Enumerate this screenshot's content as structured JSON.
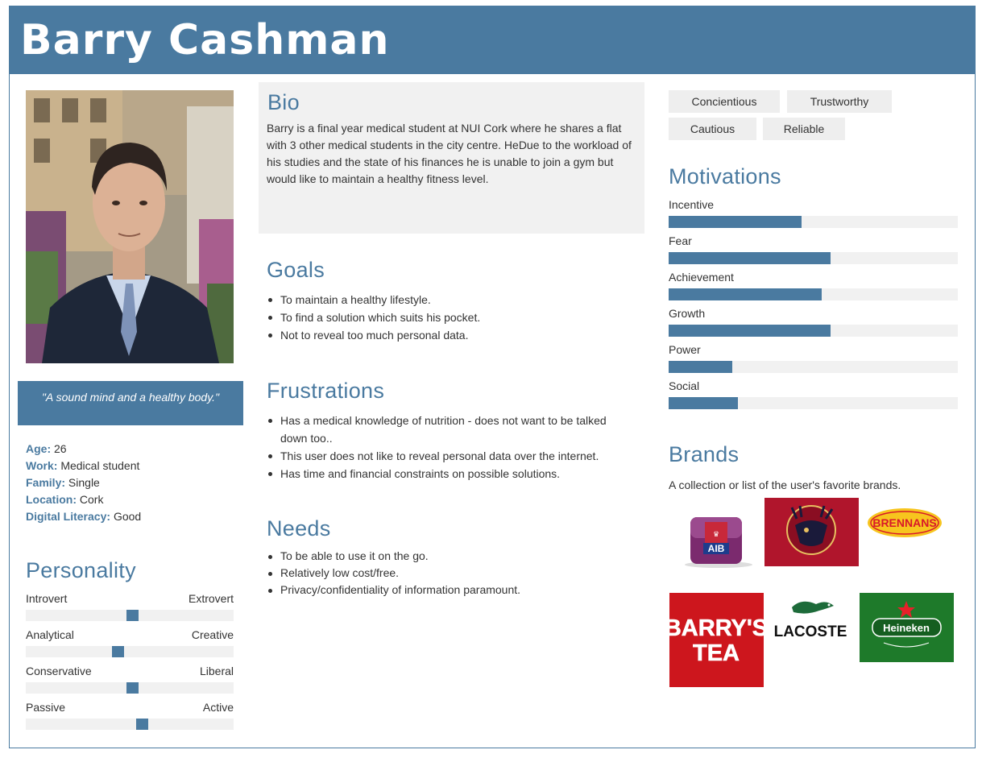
{
  "header": {
    "name": "Barry Cashman"
  },
  "quote": "\"A sound mind and a healthy body.\"",
  "facts": [
    {
      "key": "Age",
      "value": "26"
    },
    {
      "key": "Work",
      "value": "Medical student"
    },
    {
      "key": "Family",
      "value": "Single"
    },
    {
      "key": "Location",
      "value": "Cork"
    },
    {
      "key": "Digital Literacy",
      "value": "Good"
    }
  ],
  "personality": {
    "title": "Personality",
    "sliders": [
      {
        "left": "Introvert",
        "right": "Extrovert",
        "level": 0.51
      },
      {
        "left": "Analytical",
        "right": "Creative",
        "level": 0.44
      },
      {
        "left": "Conservative",
        "right": "Liberal",
        "level": 0.51
      },
      {
        "left": "Passive",
        "right": "Active",
        "level": 0.56
      }
    ]
  },
  "bio": {
    "title": "Bio",
    "text": "Barry is a final year medical student at NUI Cork where he shares a flat with 3 other medical students in the city centre. HeDue to the workload of his studies and the state of his finances he is unable to join a gym but would like to maintain a healthy fitness level."
  },
  "goals": {
    "title": "Goals",
    "items": [
      "To maintain a healthy lifestyle.",
      "To find a solution which suits his pocket.",
      "Not to reveal too much personal data."
    ]
  },
  "frustrations": {
    "title": "Frustrations",
    "items": [
      "Has a medical knowledge of nutrition - does not want to be talked down too..",
      "This user does not like to reveal personal data over the internet.",
      "Has time and financial constraints on possible solutions."
    ]
  },
  "needs": {
    "title": "Needs",
    "items": [
      "To be able to use it on the go.",
      "Relatively low cost/free.",
      "Privacy/confidentiality of information paramount."
    ]
  },
  "traits": [
    "Concientious",
    "Trustworthy",
    "Cautious",
    "Reliable"
  ],
  "motivations": {
    "title": "Motivations",
    "items": [
      {
        "label": "Incentive",
        "level": 0.46
      },
      {
        "label": "Fear",
        "level": 0.56
      },
      {
        "label": "Achievement",
        "level": 0.53
      },
      {
        "label": "Growth",
        "level": 0.56
      },
      {
        "label": "Power",
        "level": 0.22
      },
      {
        "label": "Social",
        "level": 0.24
      }
    ]
  },
  "brands": {
    "title": "Brands",
    "description": "A collection or list of the user's favorite brands.",
    "logos": {
      "aib": "AIB",
      "brennans": "BRENNANS",
      "barrys_line1": "BARRY'S",
      "barrys_line2": "TEA",
      "lacoste": "LACOSTE",
      "heineken": "Heineken"
    }
  },
  "colors": {
    "accent": "#4a7aa0",
    "panel": "#f1f1f1",
    "text": "#333333"
  }
}
